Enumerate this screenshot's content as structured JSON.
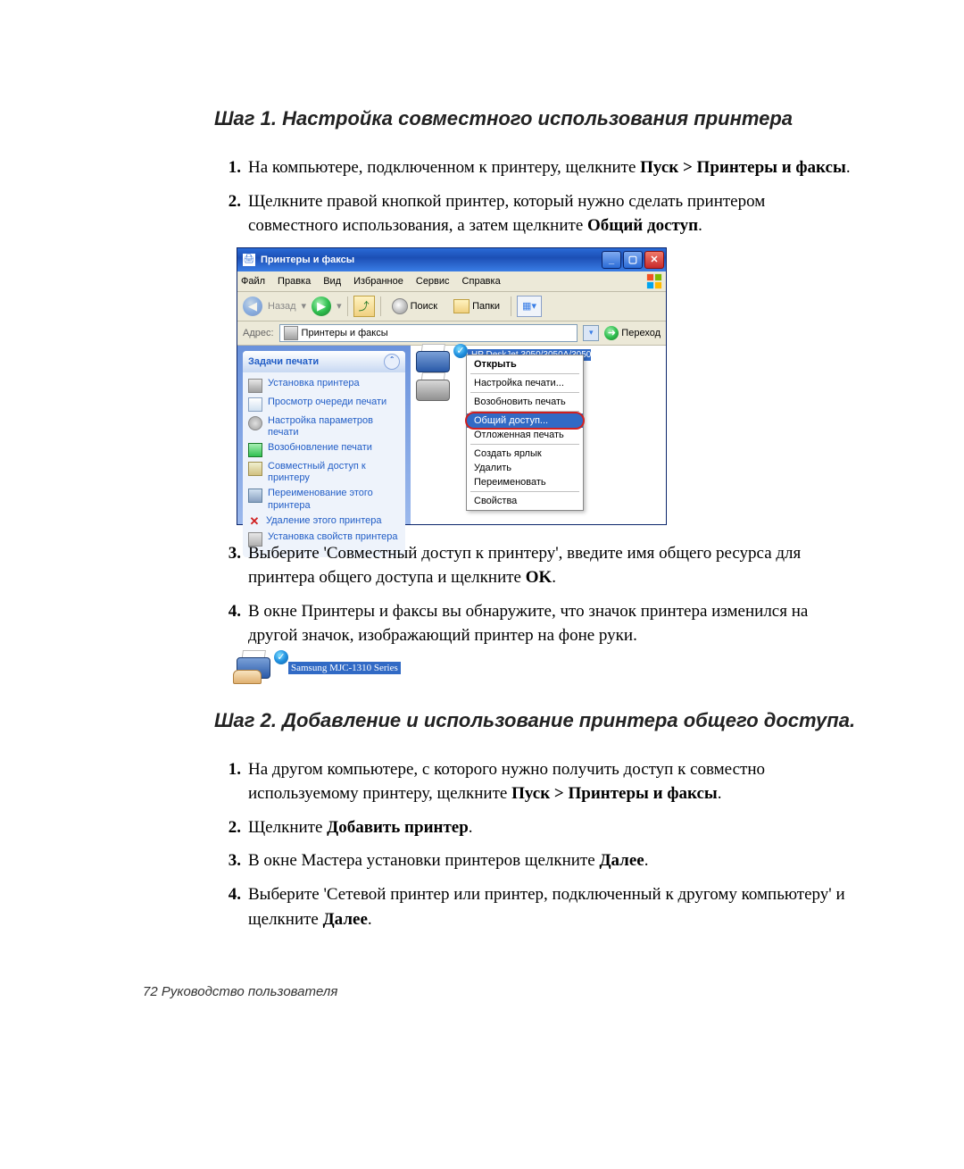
{
  "step1": {
    "heading": "Шаг 1. Настройка совместного использования принтера",
    "items": [
      {
        "num": "1.",
        "pre": "На компьютере, подключенном к принтеру, щелкните ",
        "bold1": "Пуск > Принтеры и факсы",
        "post": "."
      },
      {
        "num": "2.",
        "pre": "Щелкните правой кнопкой принтер, который нужно сделать принтером совместного использования, а затем щелкните ",
        "bold1": "Общий доступ",
        "post": "."
      },
      {
        "num": "3.",
        "pre": "Выберите 'Совместный доступ к принтеру', введите имя общего ресурса для принтера общего доступа и щелкните ",
        "bold1": "OK",
        "post": "."
      },
      {
        "num": "4.",
        "pre": "В окне Принтеры и факсы вы обнаружите, что значок принтера изменился на другой значок, изображающий принтер на фоне руки.",
        "bold1": "",
        "post": ""
      }
    ]
  },
  "step2": {
    "heading": "Шаг 2. Добавление и использование принтера общего доступа.",
    "items": [
      {
        "num": "1.",
        "pre": "На другом компьютере, с которого нужно получить доступ к совместно используемому принтеру, щелкните ",
        "bold1": "Пуск > Принтеры и факсы",
        "post": "."
      },
      {
        "num": "2.",
        "pre": "Щелкните ",
        "bold1": "Добавить принтер",
        "post": "."
      },
      {
        "num": "3.",
        "pre": "В окне Мастера установки принтеров щелкните ",
        "bold1": "Далее",
        "post": "."
      },
      {
        "num": "4.",
        "pre": "Выберите 'Сетевой принтер или принтер, подключенный к другому компьютеру' и щелкните ",
        "bold1": "Далее",
        "post": "."
      }
    ]
  },
  "xp": {
    "title": "Принтеры и факсы",
    "menu": [
      "Файл",
      "Правка",
      "Вид",
      "Избранное",
      "Сервис",
      "Справка"
    ],
    "back": "Назад",
    "search": "Поиск",
    "folders": "Папки",
    "addressLabel": "Адрес:",
    "addressValue": "Принтеры и факсы",
    "go": "Переход",
    "panelTitle": "Задачи печати",
    "tasks": [
      "Установка принтера",
      "Просмотр очереди печати",
      "Настройка параметров печати",
      "Возобновление печати",
      "Совместный доступ к принтеру",
      "Переименование этого принтера",
      "Удаление этого принтера",
      "Установка свойств принтера"
    ],
    "ctx": {
      "open": "Открыть",
      "prefs": "Настройка печати...",
      "resume": "Возобновить печать",
      "share": "Общий доступ...",
      "offline": "Отложенная печать",
      "shortcut": "Создать ярлык",
      "delete": "Удалить",
      "rename": "Переименовать",
      "props": "Свойства"
    },
    "selectedPrinter": "HP DeskJet 3050/3050A/3050"
  },
  "sharedLabel": "Samsung MJC-1310 Series",
  "footer": "72  Руководство пользователя"
}
